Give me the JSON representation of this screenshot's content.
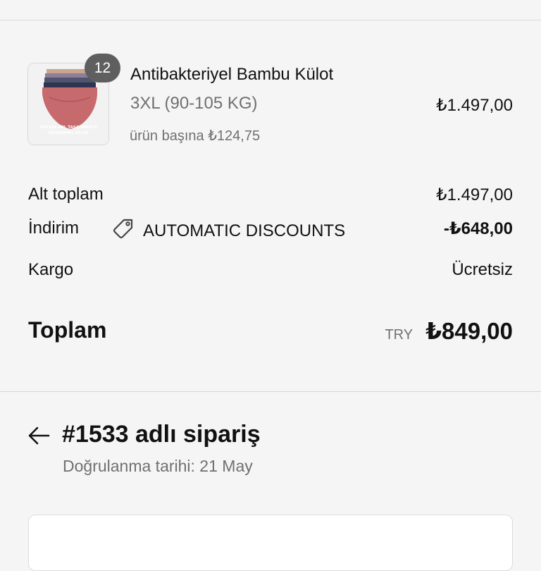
{
  "line_item": {
    "name": "Antibakteriyel Bambu Külot",
    "variant": "3XL (90-105 KG)",
    "unit_price": "ürün başına ₺124,75",
    "price": "₺1.497,00",
    "quantity": "12",
    "image_caption_line1": "YÜKSEK BEL TASARIMIYLA",
    "image_caption_line2": "MÜKEMMEL UYUM",
    "image_icon": "product-photo"
  },
  "summary": {
    "subtotal_label": "Alt toplam",
    "subtotal_value": "₺1.497,00",
    "discount_label": "İndirim",
    "discount_code": "AUTOMATIC DISCOUNTS",
    "discount_icon": "tag-icon",
    "discount_value": "-₺648,00",
    "shipping_label": "Kargo",
    "shipping_value": "Ücretsiz",
    "total_label": "Toplam",
    "total_currency": "TRY",
    "total_value": "₺849,00"
  },
  "order": {
    "back_icon": "arrow-left-icon",
    "title": "#1533 adlı sipariş",
    "subtitle": "Doğrulanma tarihi: 21 May"
  },
  "colors": {
    "background": "#f5f5f5",
    "badge": "#5f5f5f",
    "muted_text": "#707070"
  }
}
